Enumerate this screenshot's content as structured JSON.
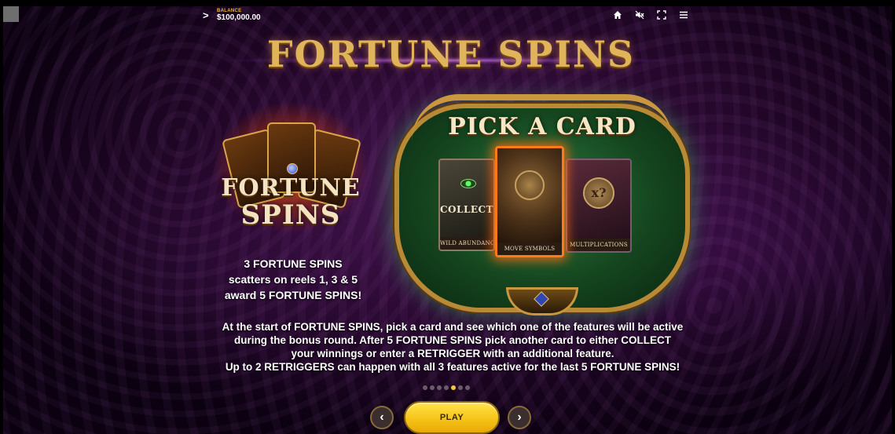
{
  "topbar": {
    "menu_glyph": ">",
    "balance_label": "BALANCE",
    "balance_value": "$100,000.00",
    "icons": [
      "home-icon",
      "sound-off-icon",
      "fullscreen-icon",
      "hamburger-menu-icon"
    ]
  },
  "title": "FORTUNE SPINS",
  "logo": {
    "line1": "FORTUNE",
    "line2": "SPINS"
  },
  "scatter_text": [
    "3 FORTUNE SPINS",
    "scatters on reels 1, 3 & 5",
    "award 5 FORTUNE SPINS!"
  ],
  "pick_card": {
    "title": "PICK A CARD",
    "cards": [
      {
        "label": "COLLECT",
        "caption": "WILD ABUNDANCE"
      },
      {
        "caption": "MOVE SYMBOLS"
      },
      {
        "symbol": "x?",
        "caption": "MULTIPLICATIONS"
      }
    ]
  },
  "description": [
    "At the start of FORTUNE SPINS, pick a card and see which one of the features will be active",
    "during the bonus round. After 5 FORTUNE SPINS pick another card to either COLLECT",
    "your winnings or enter a RETRIGGER with an additional feature.",
    "Up to 2 RETRIGGERS can happen with all 3 features active for the last 5 FORTUNE SPINS!"
  ],
  "pager": {
    "count": 7,
    "active_index": 4
  },
  "nav": {
    "prev_glyph": "‹",
    "play_label": "PLAY",
    "next_glyph": "›"
  },
  "colors": {
    "accent_gold": "#f7c418",
    "title_gold": "#e0b45a",
    "frame_green": "#2c7a40",
    "highlight_orange": "#ff7a18"
  }
}
